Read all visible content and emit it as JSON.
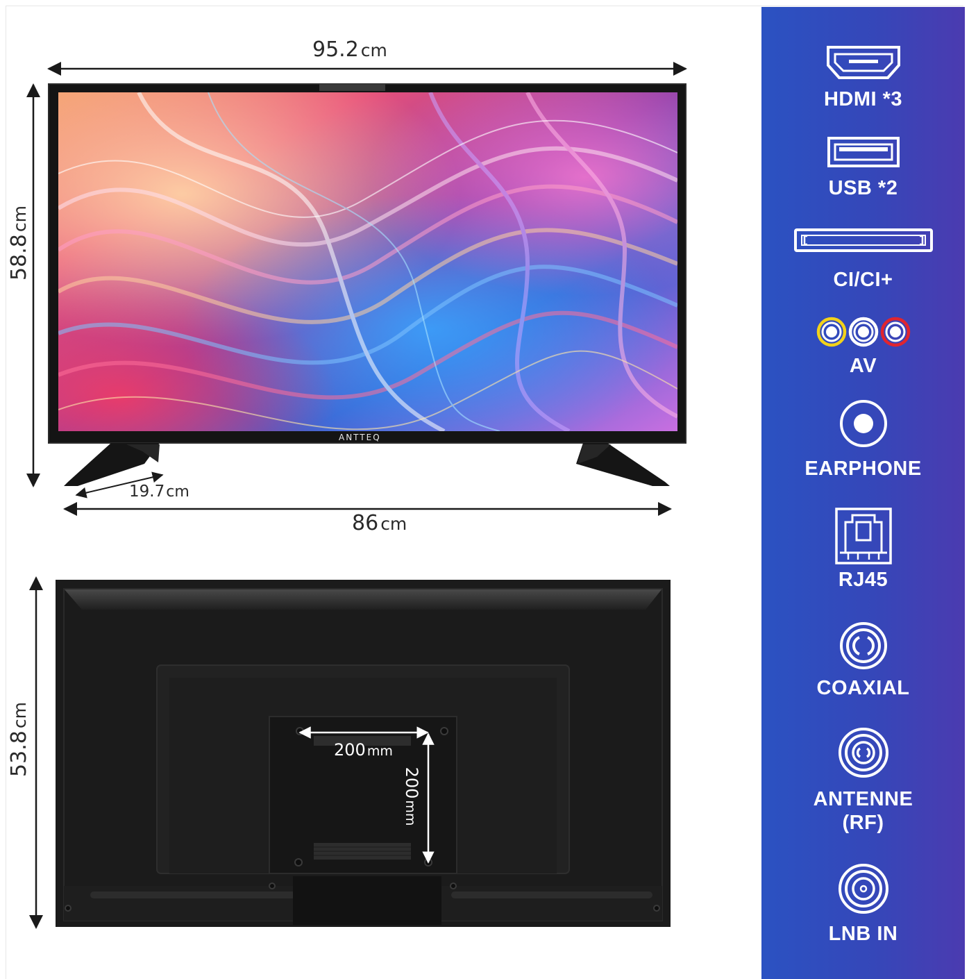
{
  "dimensions": {
    "width_total": {
      "value": "95.2",
      "unit": "cm"
    },
    "height_total": {
      "value": "58.8",
      "unit": "cm"
    },
    "stand_depth": {
      "value": "19.7",
      "unit": "cm"
    },
    "stand_span": {
      "value": "86",
      "unit": "cm"
    },
    "height_panel": {
      "value": "53.8",
      "unit": "cm"
    }
  },
  "vesa": {
    "horizontal": {
      "value": "200",
      "unit": "mm"
    },
    "vertical": {
      "value": "200",
      "unit": "mm"
    }
  },
  "brand": "ANTTEQ",
  "ports": [
    {
      "label": "HDMI *3",
      "icon": "hdmi-port-icon"
    },
    {
      "label": "USB *2",
      "icon": "usb-port-icon"
    },
    {
      "label": "CI/CI+",
      "icon": "ci-slot-icon"
    },
    {
      "label": "AV",
      "icon": "av-rca-icon"
    },
    {
      "label": "EARPHONE",
      "icon": "earphone-jack-icon"
    },
    {
      "label": "RJ45",
      "icon": "rj45-port-icon"
    },
    {
      "label": "COAXIAL",
      "icon": "coaxial-port-icon"
    },
    {
      "label": "ANTENNE",
      "label2": "(RF)",
      "icon": "antenna-rf-port-icon"
    },
    {
      "label": "LNB IN",
      "icon": "lnb-in-port-icon"
    }
  ],
  "colors": {
    "panel_start": "#2b52c2",
    "panel_end": "#4b3bb0",
    "av_yellow": "#f2d21b",
    "av_white": "#ffffff",
    "av_red": "#e0252f"
  }
}
